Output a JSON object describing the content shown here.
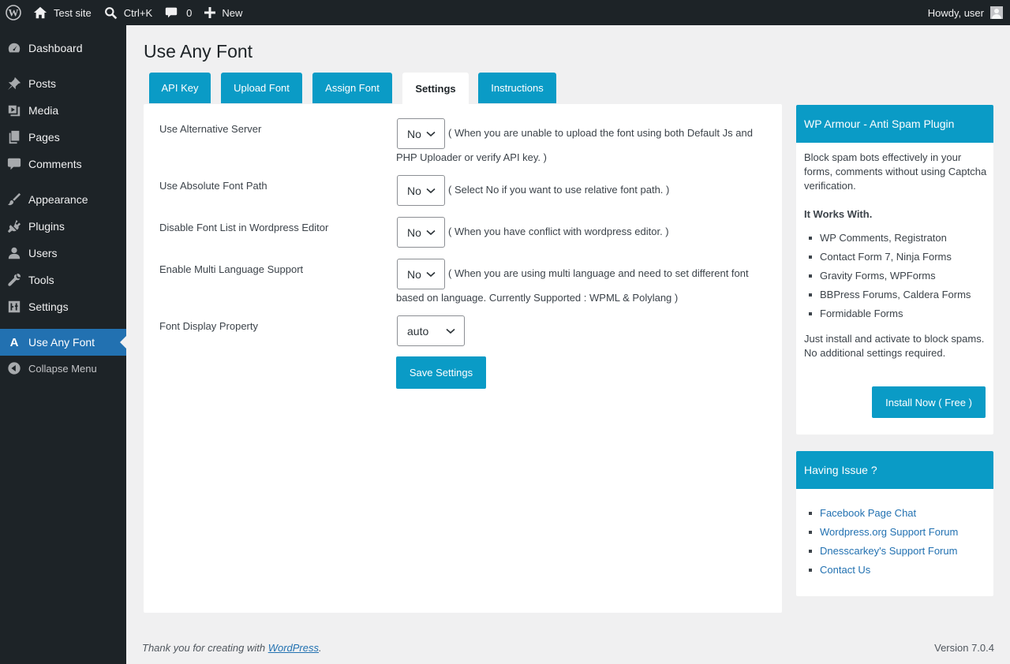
{
  "admin_bar": {
    "site_name": "Test site",
    "search_shortcut": "Ctrl+K",
    "comments_count": "0",
    "new_label": "New",
    "greeting": "Howdy, user"
  },
  "sidebar": {
    "items": [
      {
        "label": "Dashboard",
        "icon": "dashboard-icon"
      },
      {
        "label": "Posts",
        "icon": "pushpin-icon"
      },
      {
        "label": "Media",
        "icon": "media-icon"
      },
      {
        "label": "Pages",
        "icon": "pages-icon"
      },
      {
        "label": "Comments",
        "icon": "comment-icon"
      },
      {
        "label": "Appearance",
        "icon": "paintbrush-icon"
      },
      {
        "label": "Plugins",
        "icon": "plugin-icon"
      },
      {
        "label": "Users",
        "icon": "user-icon"
      },
      {
        "label": "Tools",
        "icon": "wrench-icon"
      },
      {
        "label": "Settings",
        "icon": "settings-icon"
      },
      {
        "label": "Use Any Font",
        "icon": "letter-a-icon",
        "glyph": "A"
      },
      {
        "label": "Collapse Menu",
        "icon": "collapse-icon"
      }
    ]
  },
  "page": {
    "title": "Use Any Font",
    "tabs": [
      "API Key",
      "Upload Font",
      "Assign Font",
      "Settings",
      "Instructions"
    ],
    "active_tab": "Settings"
  },
  "settings": {
    "rows": [
      {
        "label": "Use Alternative Server",
        "value": "No",
        "desc": "( When you are unable to upload the font using both Default Js and",
        "desc2": "PHP Uploader or verify API key. )"
      },
      {
        "label": "Use Absolute Font Path",
        "value": "No",
        "desc": "( Select No if you want to use relative font path. )"
      },
      {
        "label": "Disable Font List in Wordpress Editor",
        "value": "No",
        "desc": "( When you have conflict with wordpress editor. )"
      },
      {
        "label": "Enable Multi Language Support",
        "value": "No",
        "desc": "( When you are using multi language and need to set different font",
        "desc2": "based on language. Currently Supported : WPML & Polylang )"
      },
      {
        "label": "Font Display Property",
        "value": "auto"
      }
    ],
    "save_label": "Save Settings"
  },
  "promo_box": {
    "title": "WP Armour - Anti Spam Plugin",
    "intro": "Block spam bots effectively in your forms, comments without using Captcha verification.",
    "works_with_label": "It Works With.",
    "works_with": [
      "WP Comments, Registraton",
      "Contact Form 7, Ninja Forms",
      "Gravity Forms, WPForms",
      "BBPress Forums, Caldera Forms",
      "Formidable Forms"
    ],
    "outro": "Just install and activate to block spams. No additional settings required.",
    "install_label": "Install Now ( Free )"
  },
  "help_box": {
    "title": "Having Issue ?",
    "links": [
      "Facebook Page Chat",
      "Wordpress.org Support Forum",
      "Dnesscarkey's Support Forum",
      "Contact Us"
    ]
  },
  "footer": {
    "thanks_prefix": "Thank you for creating with ",
    "thanks_link": "WordPress",
    "thanks_suffix": ".",
    "version": "Version 7.0.4"
  }
}
